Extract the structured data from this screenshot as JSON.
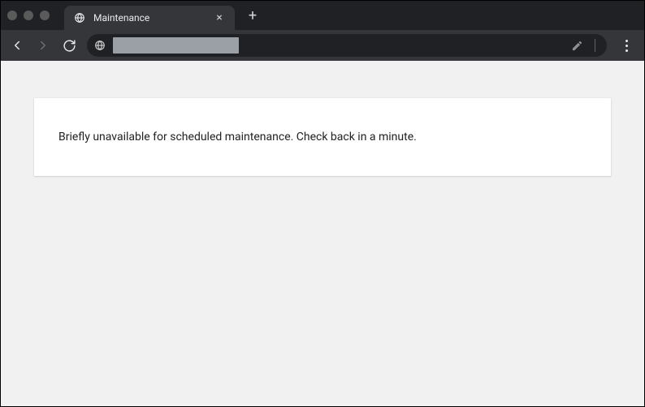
{
  "tab": {
    "title": "Maintenance"
  },
  "page": {
    "message": "Briefly unavailable for scheduled maintenance. Check back in a minute."
  }
}
